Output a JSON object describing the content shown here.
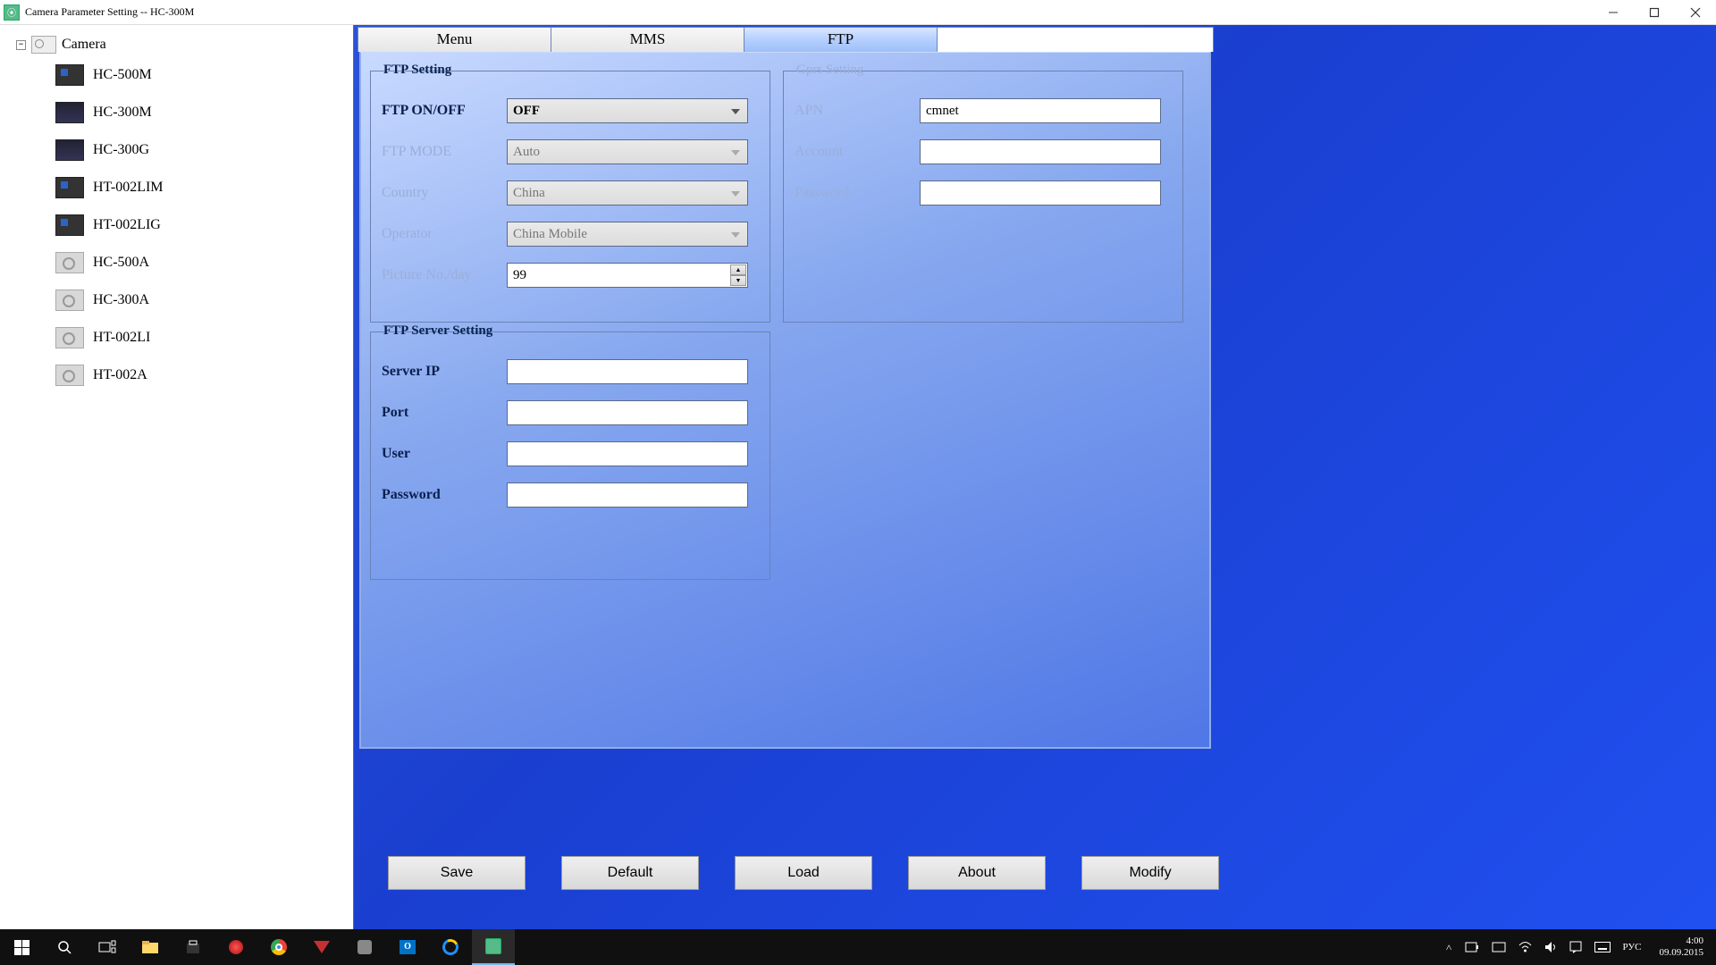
{
  "window": {
    "title": "Camera Parameter Setting -- HC-300M"
  },
  "sidebar": {
    "root_label": "Camera",
    "items": [
      {
        "label": "HC-500M",
        "iconClass": "cam"
      },
      {
        "label": "HC-300M",
        "iconClass": "walkie"
      },
      {
        "label": "HC-300G",
        "iconClass": "walkie"
      },
      {
        "label": "HT-002LIM",
        "iconClass": "cam"
      },
      {
        "label": "HT-002LIG",
        "iconClass": "cam"
      },
      {
        "label": "HC-500A",
        "iconClass": "gray"
      },
      {
        "label": "HC-300A",
        "iconClass": "gray"
      },
      {
        "label": "HT-002LI",
        "iconClass": "gray"
      },
      {
        "label": "HT-002A",
        "iconClass": "gray"
      }
    ]
  },
  "tabs": {
    "menu": "Menu",
    "mms": "MMS",
    "ftp": "FTP"
  },
  "ftp_setting": {
    "legend": "FTP Setting",
    "onoff_label": "FTP ON/OFF",
    "onoff_value": "OFF",
    "mode_label": "FTP MODE",
    "mode_value": "Auto",
    "country_label": "Country",
    "country_value": "China",
    "operator_label": "Operator",
    "operator_value": "China Mobile",
    "picno_label": "Picture No./day",
    "picno_value": "99"
  },
  "gprs_setting": {
    "legend": "Gprs Setting",
    "apn_label": "APN",
    "apn_value": "cmnet",
    "account_label": "Account",
    "account_value": "",
    "password_label": "Password",
    "password_value": ""
  },
  "server_setting": {
    "legend": "FTP Server Setting",
    "ip_label": "Server IP",
    "ip_value": "",
    "port_label": "Port",
    "port_value": "",
    "user_label": "User",
    "user_value": "",
    "password_label": "Password",
    "password_value": ""
  },
  "buttons": {
    "save": "Save",
    "default": "Default",
    "load": "Load",
    "about": "About",
    "modify": "Modify"
  },
  "taskbar": {
    "lang": "РУС",
    "time": "4:00",
    "date": "09.09.2015"
  }
}
